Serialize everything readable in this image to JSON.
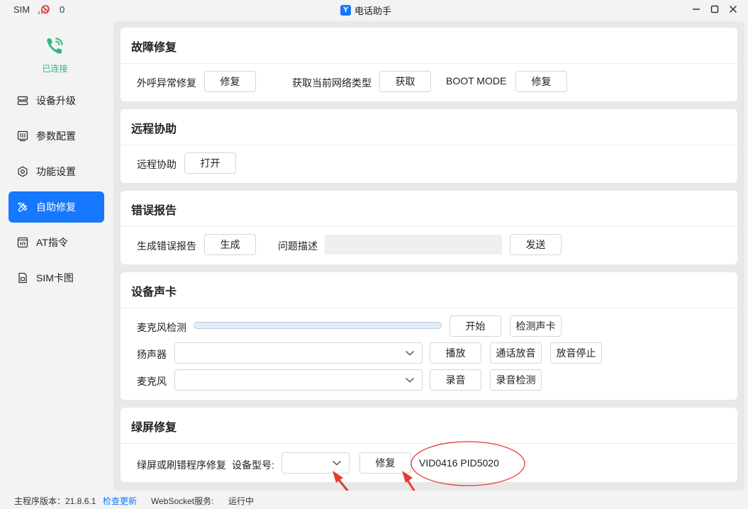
{
  "titlebar": {
    "sim_label": "SIM",
    "count": "0",
    "app_title": "电话助手",
    "logo_letter": "Y"
  },
  "sidebar": {
    "status": "已连接",
    "items": [
      {
        "label": "设备升级",
        "icon": "device-upgrade-icon"
      },
      {
        "label": "参数配置",
        "icon": "param-config-icon"
      },
      {
        "label": "功能设置",
        "icon": "settings-gear-icon"
      },
      {
        "label": "自助修复",
        "icon": "repair-tools-icon",
        "active": true
      },
      {
        "label": "AT指令",
        "icon": "code-window-icon"
      },
      {
        "label": "SIM卡图",
        "icon": "sim-card-icon"
      }
    ]
  },
  "fault_repair": {
    "title": "故障修复",
    "outgoing_label": "外呼异常修复",
    "outgoing_btn": "修复",
    "network_label": "获取当前网络类型",
    "network_btn": "获取",
    "boot_label": "BOOT MODE",
    "boot_btn": "修复"
  },
  "remote_assist": {
    "title": "远程协助",
    "label": "远程协助",
    "btn": "打开"
  },
  "error_report": {
    "title": "错误报告",
    "gen_label": "生成错误报告",
    "gen_btn": "生成",
    "desc_label": "问题描述",
    "desc_value": "",
    "send_btn": "发送"
  },
  "sound_card": {
    "title": "设备声卡",
    "mic_test_label": "麦克风检测",
    "mic_level": 0,
    "start_btn": "开始",
    "detect_btn": "检测声卡",
    "speaker_label": "扬声器",
    "speaker_value": "",
    "play_btn": "播放",
    "call_play_btn": "通话放音",
    "stop_play_btn": "放音停止",
    "mic_label": "麦克风",
    "mic_value": "",
    "record_btn": "录音",
    "record_test_btn": "录音检测"
  },
  "green_screen": {
    "title": "绿屏修复",
    "repair_label": "绿屏或刷错程序修复",
    "model_label": "设备型号:",
    "model_value": "",
    "repair_btn": "修复",
    "vid_pid": "VID0416 PID5020"
  },
  "statusbar": {
    "version_label": "主程序版本：21.8.6.1",
    "update_link": "检查更新",
    "ws_label": "WebSocket服务:",
    "ws_status": "运行中"
  },
  "colors": {
    "accent": "#1677ff",
    "connected": "#2fb87c",
    "annotation": "#e53935"
  }
}
